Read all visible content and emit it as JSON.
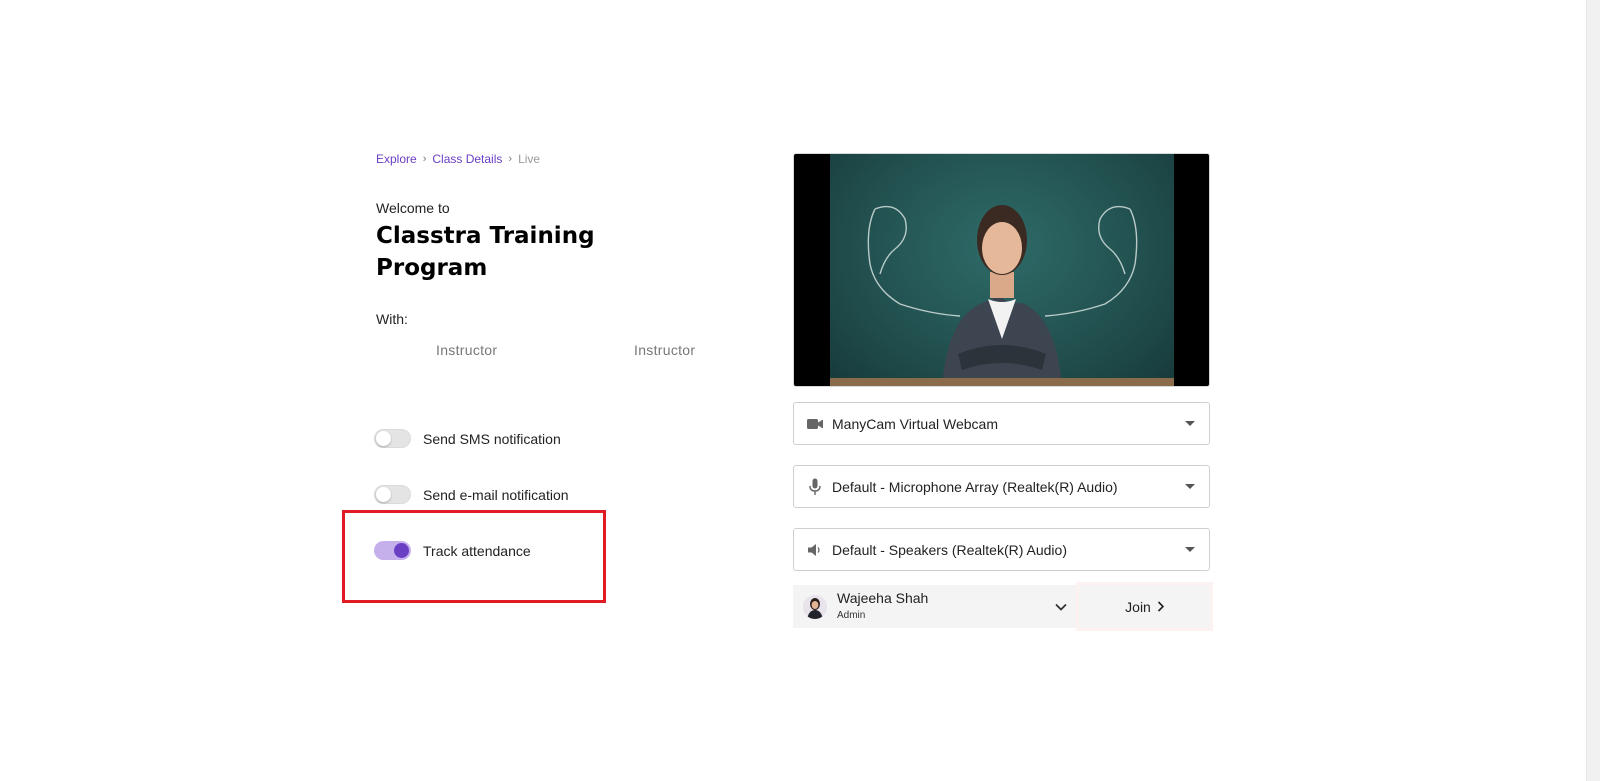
{
  "breadcrumb": {
    "items": [
      {
        "label": "Explore"
      },
      {
        "label": "Class Details"
      }
    ],
    "current": "Live",
    "separator": "›"
  },
  "welcome_text": "Welcome to",
  "title": "Classtra Training Program",
  "with_label": "With:",
  "instructors": [
    "Instructor",
    "Instructor"
  ],
  "toggles": {
    "sms": {
      "label": "Send SMS notification",
      "on": false
    },
    "email": {
      "label": "Send e-mail notification",
      "on": false
    },
    "attendance": {
      "label": "Track attendance",
      "on": true
    }
  },
  "video": {
    "icon": "webcam-preview-image"
  },
  "devices": {
    "camera": {
      "value": "ManyCam Virtual Webcam",
      "icon": "video-camera-icon"
    },
    "microphone": {
      "value": "Default - Microphone Array (Realtek(R) Audio)",
      "icon": "microphone-icon"
    },
    "speaker": {
      "value": "Default - Speakers (Realtek(R) Audio)",
      "icon": "speaker-icon"
    }
  },
  "user": {
    "name": "Wajeeha Shah",
    "role": "Admin"
  },
  "join_label": "Join",
  "colors": {
    "accent": "#6a3fc4",
    "highlight": "#e01b24"
  }
}
